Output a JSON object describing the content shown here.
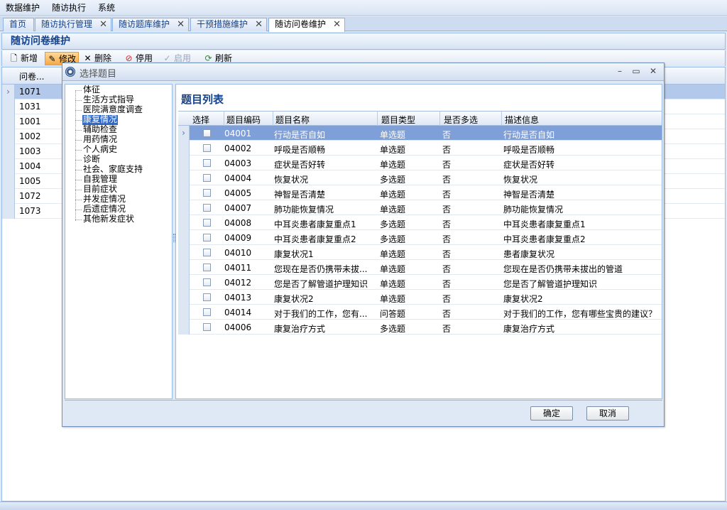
{
  "menu": [
    "数据维护",
    "随访执行",
    "系统"
  ],
  "tabs": [
    {
      "label": "首页",
      "closable": false
    },
    {
      "label": "随访执行管理",
      "closable": true
    },
    {
      "label": "随访题库维护",
      "closable": true
    },
    {
      "label": "干预措施维护",
      "closable": true
    },
    {
      "label": "随访问卷维护",
      "closable": true,
      "active": true
    }
  ],
  "page_title": "随访问卷维护",
  "toolbar": {
    "add": "新增",
    "edit": "修改",
    "delete": "删除",
    "disable": "停用",
    "enable": "启用",
    "refresh": "刷新"
  },
  "bg_grid": {
    "header": "问卷...",
    "rows": [
      "1071",
      "1031",
      "1001",
      "1002",
      "1003",
      "1004",
      "1005",
      "1072",
      "1073"
    ],
    "selected_index": 0
  },
  "dialog": {
    "title": "选择题目",
    "tree_nodes": [
      "体征",
      "生活方式指导",
      "医院满意度调查",
      "康复情况",
      "辅助检查",
      "用药情况",
      "个人病史",
      "诊断",
      "社会、家庭支持",
      "自我管理",
      "目前症状",
      "并发症情况",
      "后遗症情况",
      "其他新发症状"
    ],
    "tree_selected": 3,
    "panel_title": "题目列表",
    "columns": [
      "选择",
      "题目编码",
      "题目名称",
      "题目类型",
      "是否多选",
      "描述信息"
    ],
    "rows": [
      {
        "code": "04001",
        "name": "行动是否自如",
        "type": "单选题",
        "multi": "否",
        "desc": "行动是否自如"
      },
      {
        "code": "04002",
        "name": "呼吸是否顺畅",
        "type": "单选题",
        "multi": "否",
        "desc": "呼吸是否顺畅"
      },
      {
        "code": "04003",
        "name": "症状是否好转",
        "type": "单选题",
        "multi": "否",
        "desc": "症状是否好转"
      },
      {
        "code": "04004",
        "name": "恢复状况",
        "type": "多选题",
        "multi": "否",
        "desc": "恢复状况"
      },
      {
        "code": "04005",
        "name": "神智是否清楚",
        "type": "单选题",
        "multi": "否",
        "desc": "神智是否清楚"
      },
      {
        "code": "04007",
        "name": "肺功能恢复情况",
        "type": "单选题",
        "multi": "否",
        "desc": "肺功能恢复情况"
      },
      {
        "code": "04008",
        "name": "中耳炎患者康复重点1",
        "type": "多选题",
        "multi": "否",
        "desc": "中耳炎患者康复重点1"
      },
      {
        "code": "04009",
        "name": "中耳炎患者康复重点2",
        "type": "多选题",
        "multi": "否",
        "desc": "中耳炎患者康复重点2"
      },
      {
        "code": "04010",
        "name": "康复状况1",
        "type": "单选题",
        "multi": "否",
        "desc": "患者康复状况"
      },
      {
        "code": "04011",
        "name": "您现在是否仍携带未拔...",
        "type": "单选题",
        "multi": "否",
        "desc": "您现在是否仍携带未拔出的管道"
      },
      {
        "code": "04012",
        "name": "您是否了解管道护理知识",
        "type": "单选题",
        "multi": "否",
        "desc": "您是否了解管道护理知识"
      },
      {
        "code": "04013",
        "name": "康复状况2",
        "type": "单选题",
        "multi": "否",
        "desc": "康复状况2"
      },
      {
        "code": "04014",
        "name": "对于我们的工作，您有...",
        "type": "问答题",
        "multi": "否",
        "desc": "对于我们的工作，您有哪些宝贵的建议？"
      },
      {
        "code": "04006",
        "name": "康复治疗方式",
        "type": "多选题",
        "multi": "否",
        "desc": "康复治疗方式"
      }
    ],
    "selected_row": 0,
    "ok_label": "确定",
    "cancel_label": "取消"
  }
}
